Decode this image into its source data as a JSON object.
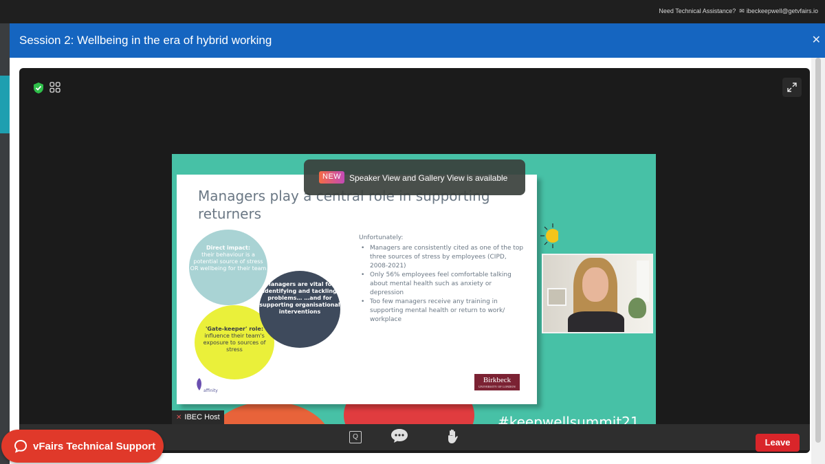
{
  "topbar": {
    "assist_label": "Need Technical Assistance?",
    "email": "ibeckeepwell@getvfairs.io"
  },
  "modal": {
    "title": "Session 2: Wellbeing in the era of hybrid working",
    "close_symbol": "✕"
  },
  "slide": {
    "title": "Managers play a central role in supporting returners",
    "circle_direct_heading": "Direct impact:",
    "circle_direct_text": "their behaviour is a potential source of stress OR wellbeing for their team",
    "circle_managers_text": "Managers are vital for identifying and tackling problems… …and for supporting organisational interventions",
    "circle_gatekeeper_heading": "'Gate-keeper' role:",
    "circle_gatekeeper_text": "influence their team's exposure to sources of stress",
    "intro": "Unfortunately:",
    "bullets": [
      "Managers are consistently cited as one of the top three sources of stress by employees (CIPD, 2008-2021)",
      "Only 56% employees feel comfortable talking about mental health such as anxiety or depression",
      "Too few managers receive any training in supporting mental health or return to work/ workplace"
    ],
    "affinity_logo_text": "affinity",
    "birkbeck_logo_text": "Birkbeck",
    "birkbeck_logo_sub": "UNIVERSITY OF LONDON"
  },
  "share": {
    "hashtag": "#keepwellsummit21",
    "host_label": "IBEC Host"
  },
  "notice": {
    "badge": "NEW",
    "message": "Speaker View and Gallery View is available"
  },
  "controls": {
    "q_label": "Q",
    "leave_label": "Leave"
  },
  "support": {
    "label": "vFairs Technical Support"
  },
  "colors": {
    "header_blue": "#1565c0",
    "leave_red": "#d9252a",
    "support_red": "#e0392a",
    "share_teal": "#47c1a6"
  }
}
